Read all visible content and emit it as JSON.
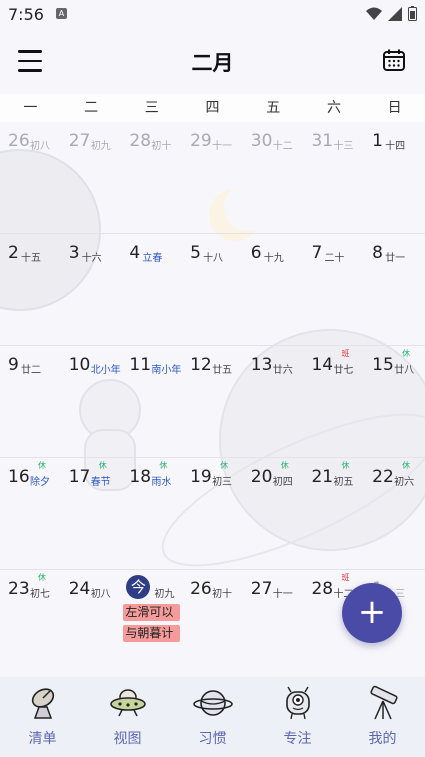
{
  "status_bar": {
    "time": "7:56",
    "badge": "A"
  },
  "header": {
    "title": "二月"
  },
  "weekdays": [
    "一",
    "二",
    "三",
    "四",
    "五",
    "六",
    "日"
  ],
  "weeks": [
    [
      {
        "day": "26",
        "lunar": "初八",
        "dim": true
      },
      {
        "day": "27",
        "lunar": "初九",
        "dim": true
      },
      {
        "day": "28",
        "lunar": "初十",
        "dim": true
      },
      {
        "day": "29",
        "lunar": "十一",
        "dim": true
      },
      {
        "day": "30",
        "lunar": "十二",
        "dim": true
      },
      {
        "day": "31",
        "lunar": "十三",
        "dim": true
      },
      {
        "day": "1",
        "lunar": "十四"
      }
    ],
    [
      {
        "day": "2",
        "lunar": "十五"
      },
      {
        "day": "3",
        "lunar": "十六"
      },
      {
        "day": "4",
        "lunar": "立春",
        "solar": true
      },
      {
        "day": "5",
        "lunar": "十八"
      },
      {
        "day": "6",
        "lunar": "十九"
      },
      {
        "day": "7",
        "lunar": "二十"
      },
      {
        "day": "8",
        "lunar": "廿一"
      }
    ],
    [
      {
        "day": "9",
        "lunar": "廿二"
      },
      {
        "day": "10",
        "lunar": "北小年",
        "solar": true
      },
      {
        "day": "11",
        "lunar": "南小年",
        "solar": true
      },
      {
        "day": "12",
        "lunar": "廿五"
      },
      {
        "day": "13",
        "lunar": "廿六"
      },
      {
        "day": "14",
        "lunar": "廿七",
        "tag": "班",
        "tag_type": "work"
      },
      {
        "day": "15",
        "lunar": "廿八",
        "tag": "休",
        "tag_type": "rest"
      }
    ],
    [
      {
        "day": "16",
        "lunar": "除夕",
        "solar": true,
        "tag": "休",
        "tag_type": "rest"
      },
      {
        "day": "17",
        "lunar": "春节",
        "solar": true,
        "tag": "休",
        "tag_type": "rest"
      },
      {
        "day": "18",
        "lunar": "雨水",
        "solar": true,
        "tag": "休",
        "tag_type": "rest"
      },
      {
        "day": "19",
        "lunar": "初三",
        "tag": "休",
        "tag_type": "rest"
      },
      {
        "day": "20",
        "lunar": "初四",
        "tag": "休",
        "tag_type": "rest"
      },
      {
        "day": "21",
        "lunar": "初五",
        "tag": "休",
        "tag_type": "rest"
      },
      {
        "day": "22",
        "lunar": "初六",
        "tag": "休",
        "tag_type": "rest"
      }
    ],
    [
      {
        "day": "23",
        "lunar": "初七",
        "tag": "休",
        "tag_type": "rest"
      },
      {
        "day": "24",
        "lunar": "初八"
      },
      {
        "day": "今",
        "lunar": "初九",
        "today": true,
        "events": [
          "左滑可以",
          "与朝暮计"
        ]
      },
      {
        "day": "26",
        "lunar": "初十"
      },
      {
        "day": "27",
        "lunar": "十一"
      },
      {
        "day": "28",
        "lunar": "十二",
        "tag": "班",
        "tag_type": "work"
      },
      {
        "day": "1",
        "lunar": "十三",
        "dim": true
      }
    ]
  ],
  "fab": {
    "label": "+"
  },
  "tabs": [
    {
      "label": "清单",
      "icon": "satellite-dish-icon"
    },
    {
      "label": "视图",
      "icon": "ufo-icon"
    },
    {
      "label": "习惯",
      "icon": "planet-icon"
    },
    {
      "label": "专注",
      "icon": "alien-icon"
    },
    {
      "label": "我的",
      "icon": "telescope-icon"
    }
  ],
  "colors": {
    "accent": "#4a4ba6",
    "today": "#2f3c86",
    "event_bg": "#f59b9b",
    "rest_tag": "#23b36a",
    "work_tag": "#e03333",
    "solar_term": "#2b58c8",
    "tab_label": "#5c67b0"
  }
}
